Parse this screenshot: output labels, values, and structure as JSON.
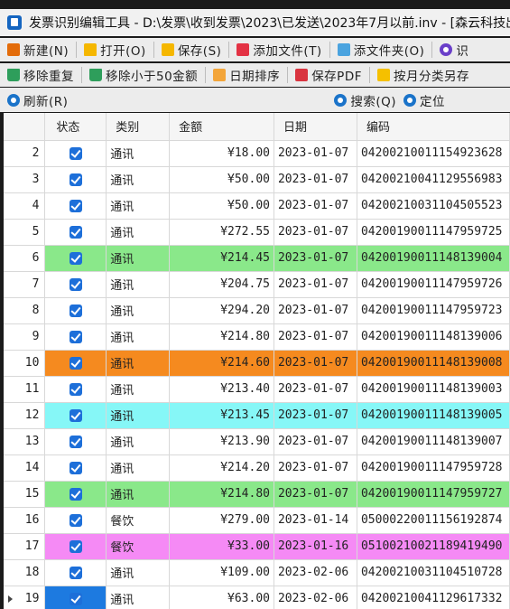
{
  "window": {
    "title": "发票识别编辑工具 - D:\\发票\\收到发票\\2023\\已发送\\2023年7月以前.inv - [森云科技出品"
  },
  "toolbar1": [
    {
      "name": "new-button",
      "icon": "new-icon",
      "cls": "ic-new",
      "label": "新建(N)"
    },
    {
      "name": "open-button",
      "icon": "folder-icon",
      "cls": "ic-folder",
      "label": "打开(O)"
    },
    {
      "name": "save-button",
      "icon": "save-icon",
      "cls": "ic-save",
      "label": "保存(S)"
    },
    {
      "name": "add-file-button",
      "icon": "add-file-icon",
      "cls": "ic-addfile",
      "label": "添加文件(T)"
    },
    {
      "name": "add-folder-button",
      "icon": "add-folder-icon",
      "cls": "ic-addfolder",
      "label": "添文件夹(O)"
    },
    {
      "name": "recognize-button",
      "icon": "recognize-icon",
      "cls": "ic-circle",
      "label": "识"
    }
  ],
  "toolbar2": [
    {
      "name": "remove-duplicates-button",
      "icon": "trash-icon",
      "cls": "ic-trash",
      "label": "移除重复"
    },
    {
      "name": "remove-under-50-button",
      "icon": "trash-icon",
      "cls": "ic-trash",
      "label": "移除小于50金额"
    },
    {
      "name": "date-sort-button",
      "icon": "date-icon",
      "cls": "ic-date",
      "label": "日期排序"
    },
    {
      "name": "save-pdf-button",
      "icon": "pdf-icon",
      "cls": "ic-pdf",
      "label": "保存PDF"
    },
    {
      "name": "save-by-month-button",
      "icon": "folder-icon",
      "cls": "ic-month",
      "label": "按月分类另存"
    }
  ],
  "toolbar3": {
    "refresh": "刷新(R)",
    "search": "搜索(Q)",
    "locate": "定位"
  },
  "table": {
    "headers": [
      "",
      "状态",
      "类别",
      "金额",
      "日期",
      "编码"
    ],
    "rows": [
      {
        "num": "2",
        "checked": true,
        "category": "通讯",
        "amount": "¥18.00",
        "date": "2023-01-07",
        "code": "04200210011154923628",
        "color": ""
      },
      {
        "num": "3",
        "checked": true,
        "category": "通讯",
        "amount": "¥50.00",
        "date": "2023-01-07",
        "code": "04200210041129556983",
        "color": ""
      },
      {
        "num": "4",
        "checked": true,
        "category": "通讯",
        "amount": "¥50.00",
        "date": "2023-01-07",
        "code": "04200210031104505523",
        "color": ""
      },
      {
        "num": "5",
        "checked": true,
        "category": "通讯",
        "amount": "¥272.55",
        "date": "2023-01-07",
        "code": "04200190011147959725",
        "color": ""
      },
      {
        "num": "6",
        "checked": true,
        "category": "通讯",
        "amount": "¥214.45",
        "date": "2023-01-07",
        "code": "04200190011148139004",
        "color": "#8ae88a"
      },
      {
        "num": "7",
        "checked": true,
        "category": "通讯",
        "amount": "¥204.75",
        "date": "2023-01-07",
        "code": "04200190011147959726",
        "color": ""
      },
      {
        "num": "8",
        "checked": true,
        "category": "通讯",
        "amount": "¥294.20",
        "date": "2023-01-07",
        "code": "04200190011147959723",
        "color": ""
      },
      {
        "num": "9",
        "checked": true,
        "category": "通讯",
        "amount": "¥214.80",
        "date": "2023-01-07",
        "code": "04200190011148139006",
        "color": ""
      },
      {
        "num": "10",
        "checked": true,
        "category": "通讯",
        "amount": "¥214.60",
        "date": "2023-01-07",
        "code": "04200190011148139008",
        "color": "#f58a1f"
      },
      {
        "num": "11",
        "checked": true,
        "category": "通讯",
        "amount": "¥213.40",
        "date": "2023-01-07",
        "code": "04200190011148139003",
        "color": ""
      },
      {
        "num": "12",
        "checked": true,
        "category": "通讯",
        "amount": "¥213.45",
        "date": "2023-01-07",
        "code": "04200190011148139005",
        "color": "#86f7f7"
      },
      {
        "num": "13",
        "checked": true,
        "category": "通讯",
        "amount": "¥213.90",
        "date": "2023-01-07",
        "code": "04200190011148139007",
        "color": ""
      },
      {
        "num": "14",
        "checked": true,
        "category": "通讯",
        "amount": "¥214.20",
        "date": "2023-01-07",
        "code": "04200190011147959728",
        "color": ""
      },
      {
        "num": "15",
        "checked": true,
        "category": "通讯",
        "amount": "¥214.80",
        "date": "2023-01-07",
        "code": "04200190011147959727",
        "color": "#8ae88a"
      },
      {
        "num": "16",
        "checked": true,
        "category": "餐饮",
        "amount": "¥279.00",
        "date": "2023-01-14",
        "code": "05000220011156192874",
        "color": ""
      },
      {
        "num": "17",
        "checked": true,
        "category": "餐饮",
        "amount": "¥33.00",
        "date": "2023-01-16",
        "code": "05100210021189419490",
        "color": "#f58af5"
      },
      {
        "num": "18",
        "checked": true,
        "category": "通讯",
        "amount": "¥109.00",
        "date": "2023-02-06",
        "code": "04200210031104510728",
        "color": ""
      },
      {
        "num": "19",
        "checked": true,
        "category": "通讯",
        "amount": "¥63.00",
        "date": "2023-02-06",
        "code": "04200210041129617332",
        "color": "",
        "current": true
      }
    ]
  }
}
